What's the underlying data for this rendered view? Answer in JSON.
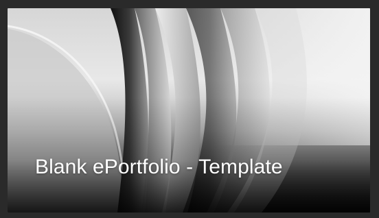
{
  "card": {
    "title": "Blank ePortfolio - Template",
    "image": "book-pages-photo",
    "title_color": "#ffffff",
    "frame_color": "#2a2a2a"
  }
}
